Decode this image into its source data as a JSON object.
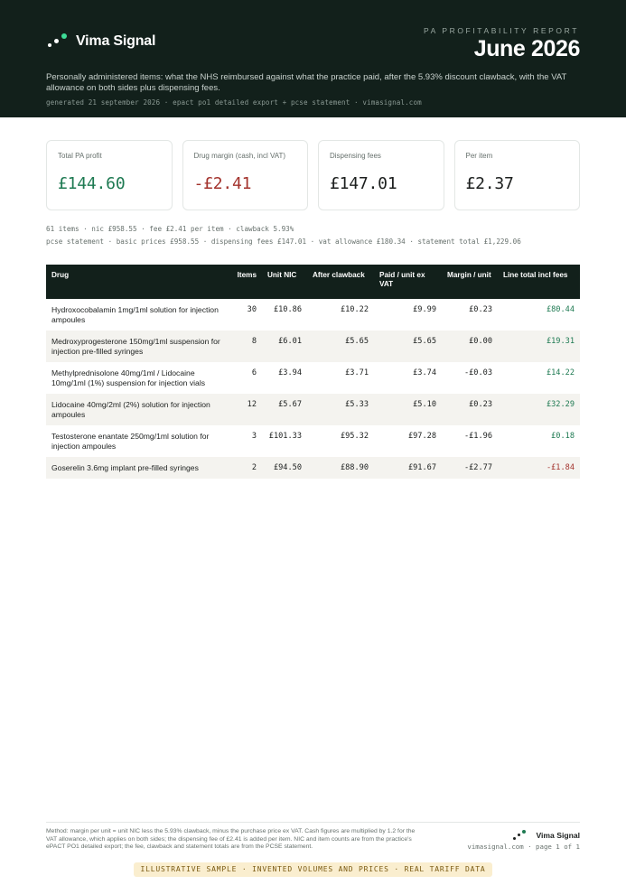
{
  "header": {
    "brand": "Vima Signal",
    "report_label": "PA PROFITABILITY REPORT",
    "month": "June 2026",
    "description": "Personally administered items: what the NHS reimbursed against what the practice paid, after the 5.93% discount clawback, with the VAT allowance on both sides plus dispensing fees.",
    "meta": "generated 21 september 2026 · epact po1 detailed export + pcse statement · vimasignal.com"
  },
  "cards": [
    {
      "label": "Total PA profit",
      "value": "£144.60",
      "tone": "pos"
    },
    {
      "label": "Drug margin (cash, incl VAT)",
      "value": "-£2.41",
      "tone": "neg"
    },
    {
      "label": "Dispensing fees",
      "value": "£147.01",
      "tone": "neu"
    },
    {
      "label": "Per item",
      "value": "£2.37",
      "tone": "neu"
    }
  ],
  "summary": {
    "line1": "61 items · nic £958.55 · fee £2.41 per item · clawback 5.93%",
    "line2": "pcse statement · basic prices £958.55 · dispensing fees £147.01 · vat allowance £180.34 · statement total £1,229.06"
  },
  "table": {
    "headers": {
      "drug": "Drug",
      "items": "Items",
      "unit_nic": "Unit NIC",
      "after_clawback": "After clawback",
      "paid": "Paid / unit ex VAT",
      "margin": "Margin / unit",
      "line_total": "Line total incl fees"
    },
    "rows": [
      {
        "drug": "Hydroxocobalamin 1mg/1ml solution for injection ampoules",
        "items": "30",
        "unit_nic": "£10.86",
        "after_clawback": "£10.22",
        "paid": "£9.99",
        "margin": "£0.23",
        "line_total": "£80.44",
        "tone": "pos"
      },
      {
        "drug": "Medroxyprogesterone 150mg/1ml suspension for injection pre-filled syringes",
        "items": "8",
        "unit_nic": "£6.01",
        "after_clawback": "£5.65",
        "paid": "£5.65",
        "margin": "£0.00",
        "line_total": "£19.31",
        "tone": "pos"
      },
      {
        "drug": "Methylprednisolone 40mg/1ml / Lidocaine 10mg/1ml (1%) suspension for injection vials",
        "items": "6",
        "unit_nic": "£3.94",
        "after_clawback": "£3.71",
        "paid": "£3.74",
        "margin": "-£0.03",
        "line_total": "£14.22",
        "tone": "pos"
      },
      {
        "drug": "Lidocaine 40mg/2ml (2%) solution for injection ampoules",
        "items": "12",
        "unit_nic": "£5.67",
        "after_clawback": "£5.33",
        "paid": "£5.10",
        "margin": "£0.23",
        "line_total": "£32.29",
        "tone": "pos"
      },
      {
        "drug": "Testosterone enantate 250mg/1ml solution for injection ampoules",
        "items": "3",
        "unit_nic": "£101.33",
        "after_clawback": "£95.32",
        "paid": "£97.28",
        "margin": "-£1.96",
        "line_total": "£0.18",
        "tone": "pos"
      },
      {
        "drug": "Goserelin 3.6mg implant pre-filled syringes",
        "items": "2",
        "unit_nic": "£94.50",
        "after_clawback": "£88.90",
        "paid": "£91.67",
        "margin": "-£2.77",
        "line_total": "-£1.84",
        "tone": "neg"
      }
    ]
  },
  "footer": {
    "method": "Method: margin per unit = unit NIC less the 5.93% clawback, minus the purchase price ex VAT. Cash figures are multiplied by 1.2 for the VAT allowance, which applies on both sides; the dispensing fee of £2.41 is added per item. NIC and item counts are from the practice's ePACT PO1 detailed export; the fee, clawback and statement totals are from the PCSE statement.",
    "brand": "Vima Signal",
    "page": "vimasignal.com · page 1 of 1",
    "badge": "ILLUSTRATIVE SAMPLE · INVENTED VOLUMES AND PRICES · REAL TARIFF DATA"
  },
  "colors": {
    "header_bg": "#12201b",
    "positive": "#1e7a52",
    "negative": "#a3332d",
    "brand_accent": "#3ddc97",
    "badge_bg": "#faeecf"
  },
  "icons": {
    "brand": "vima-signal-dots-logo"
  }
}
